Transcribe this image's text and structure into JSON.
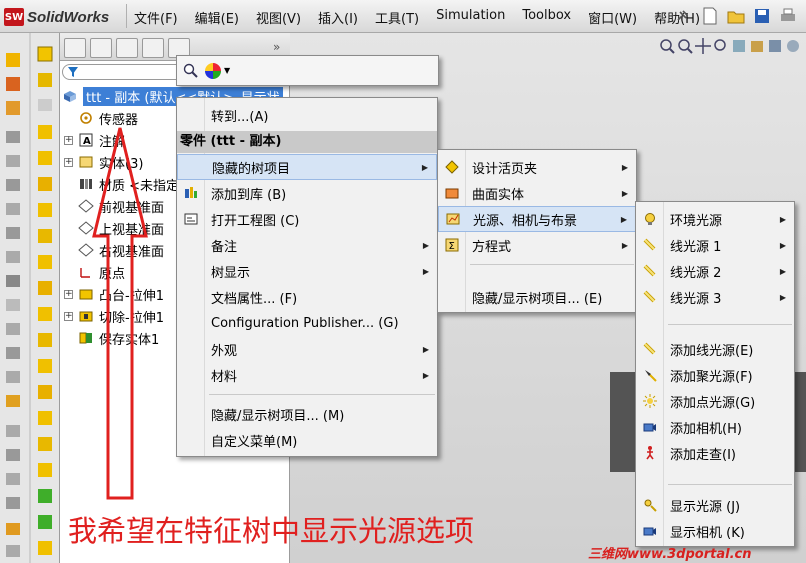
{
  "app": {
    "logo_badge": "SW",
    "name": "SolidWorks"
  },
  "menubar": [
    "文件(F)",
    "编辑(E)",
    "视图(V)",
    "插入(I)",
    "工具(T)",
    "Simulation",
    "Toolbox",
    "窗口(W)",
    "帮助(H)"
  ],
  "tree": {
    "root_label": "ttt - 副本  (默认<<默认>_显示状",
    "items": [
      {
        "label": "传感器",
        "expand": false,
        "icon": "sensor-icon"
      },
      {
        "label": "注解",
        "expand": true,
        "icon": "annotation-icon"
      },
      {
        "label": "实体(3)",
        "expand": true,
        "icon": "solid-bodies-icon"
      },
      {
        "label": "材质 <未指定>",
        "expand": false,
        "icon": "material-icon"
      },
      {
        "label": "前视基准面",
        "expand": false,
        "icon": "plane-icon"
      },
      {
        "label": "上视基准面",
        "expand": false,
        "icon": "plane-icon"
      },
      {
        "label": "右视基准面",
        "expand": false,
        "icon": "plane-icon"
      },
      {
        "label": "原点",
        "expand": false,
        "icon": "origin-icon"
      },
      {
        "label": "凸台-拉伸1",
        "expand": true,
        "icon": "boss-extrude-icon"
      },
      {
        "label": "切除-拉伸1",
        "expand": true,
        "icon": "cut-extrude-icon"
      },
      {
        "label": "保存实体1",
        "expand": false,
        "icon": "save-bodies-icon"
      }
    ]
  },
  "context_menu": {
    "goto": "转到...(A)",
    "header": "零件 (ttt - 副本)",
    "items": [
      {
        "label": "隐藏的树项目",
        "submenu": true,
        "highlight": true
      },
      {
        "label": "添加到库 (B)",
        "submenu": false,
        "icon": "add-to-library-icon"
      },
      {
        "label": "打开工程图 (C)",
        "submenu": false,
        "icon": "drawing-icon"
      },
      {
        "label": "备注",
        "submenu": true
      },
      {
        "label": "树显示",
        "submenu": true
      },
      {
        "label": "文档属性... (F)",
        "submenu": false
      },
      {
        "label": "Configuration Publisher... (G)",
        "submenu": false
      },
      {
        "label": "外观",
        "submenu": true
      },
      {
        "label": "材料",
        "submenu": true
      }
    ],
    "footer": [
      "隐藏/显示树项目... (M)",
      "自定义菜单(M)"
    ]
  },
  "submenu_hidden": {
    "items": [
      {
        "label": "设计活页夹",
        "submenu": true
      },
      {
        "label": "曲面实体",
        "submenu": true
      },
      {
        "label": "光源、相机与布景",
        "submenu": true,
        "highlight": true
      },
      {
        "label": "方程式",
        "submenu": true
      }
    ],
    "footer": "隐藏/显示树项目... (E)"
  },
  "submenu_lights": {
    "items": [
      {
        "label": "环境光源",
        "submenu": true
      },
      {
        "label": "线光源 1",
        "submenu": true
      },
      {
        "label": "线光源 2",
        "submenu": true
      },
      {
        "label": "线光源 3",
        "submenu": true
      }
    ],
    "add_items": [
      "添加线光源(E)",
      "添加聚光源(F)",
      "添加点光源(G)",
      "添加相机(H)",
      "添加走查(I)"
    ],
    "show_items": [
      "显示光源 (J)",
      "显示相机 (K)"
    ]
  },
  "annotation_text": "我希望在特征树中显示光源选项",
  "watermark": "三维网www.3dportal.cn",
  "colors": {
    "annotation": "#e0201f",
    "selection": "#3d7fd6",
    "menu_highlight": "#d6e4f5"
  }
}
